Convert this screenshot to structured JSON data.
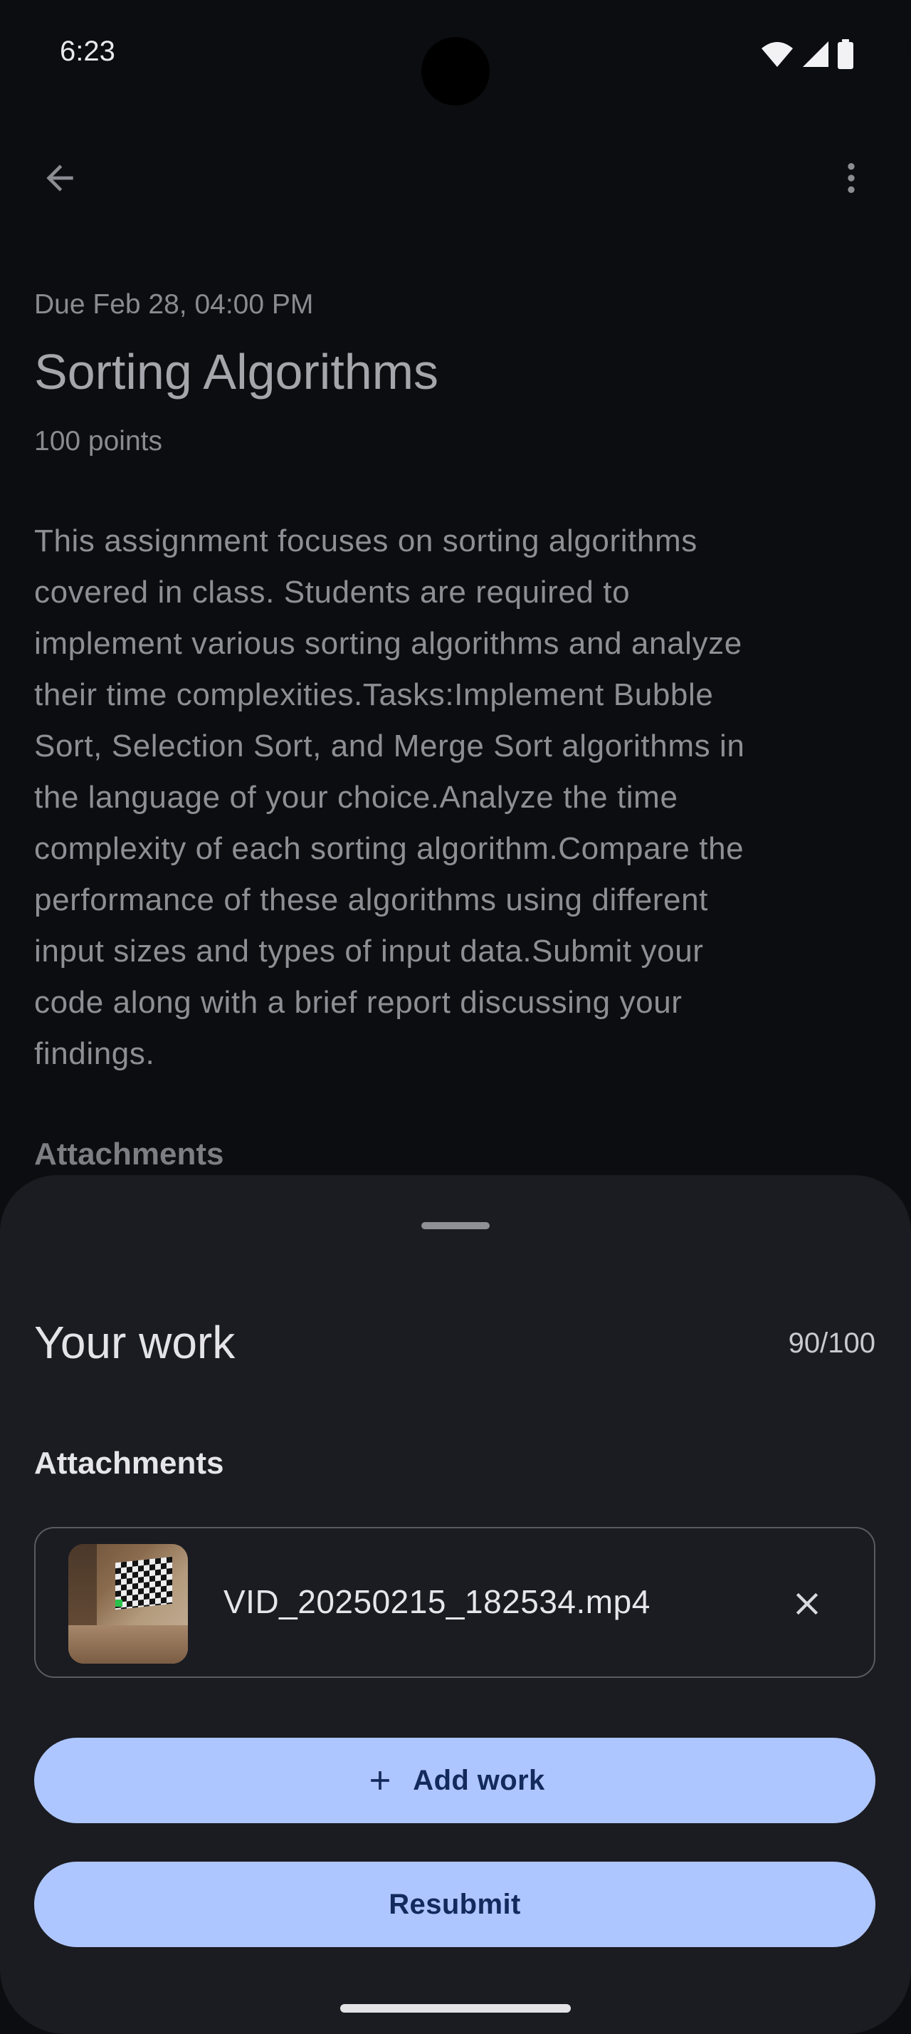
{
  "status_bar": {
    "time": "6:23",
    "icons": [
      "wifi-icon",
      "cellular-signal-icon",
      "battery-icon"
    ]
  },
  "app_bar": {
    "back_icon": "arrow-back-icon",
    "more_icon": "more-vert-icon"
  },
  "assignment": {
    "due": "Due Feb 28, 04:00 PM",
    "title": "Sorting Algorithms",
    "points": "100 points",
    "description": "This assignment focuses on sorting algorithms\ncovered in class. Students are required to\nimplement various sorting algorithms and analyze\ntheir time complexities.Tasks:Implement Bubble\nSort, Selection Sort, and Merge Sort algorithms in\nthe language of your choice.Analyze the time\ncomplexity of each sorting algorithm.Compare the\nperformance of these algorithms using different\ninput sizes and types of input data.Submit your\ncode along with a brief report discussing your\nfindings.",
    "attachments_label": "Attachments"
  },
  "sheet": {
    "title": "Your work",
    "grade": "90/100",
    "attachments_label": "Attachments",
    "attachment": {
      "file_name": "VID_20250215_182534.mp4",
      "remove_icon": "close-icon"
    },
    "add_work_label": "Add work",
    "add_icon": "plus-icon",
    "resubmit_label": "Resubmit"
  },
  "colors": {
    "background": "#0c0d11",
    "sheet": "#1b1c21",
    "button": "#aec6ff",
    "button_text": "#122a5c"
  }
}
